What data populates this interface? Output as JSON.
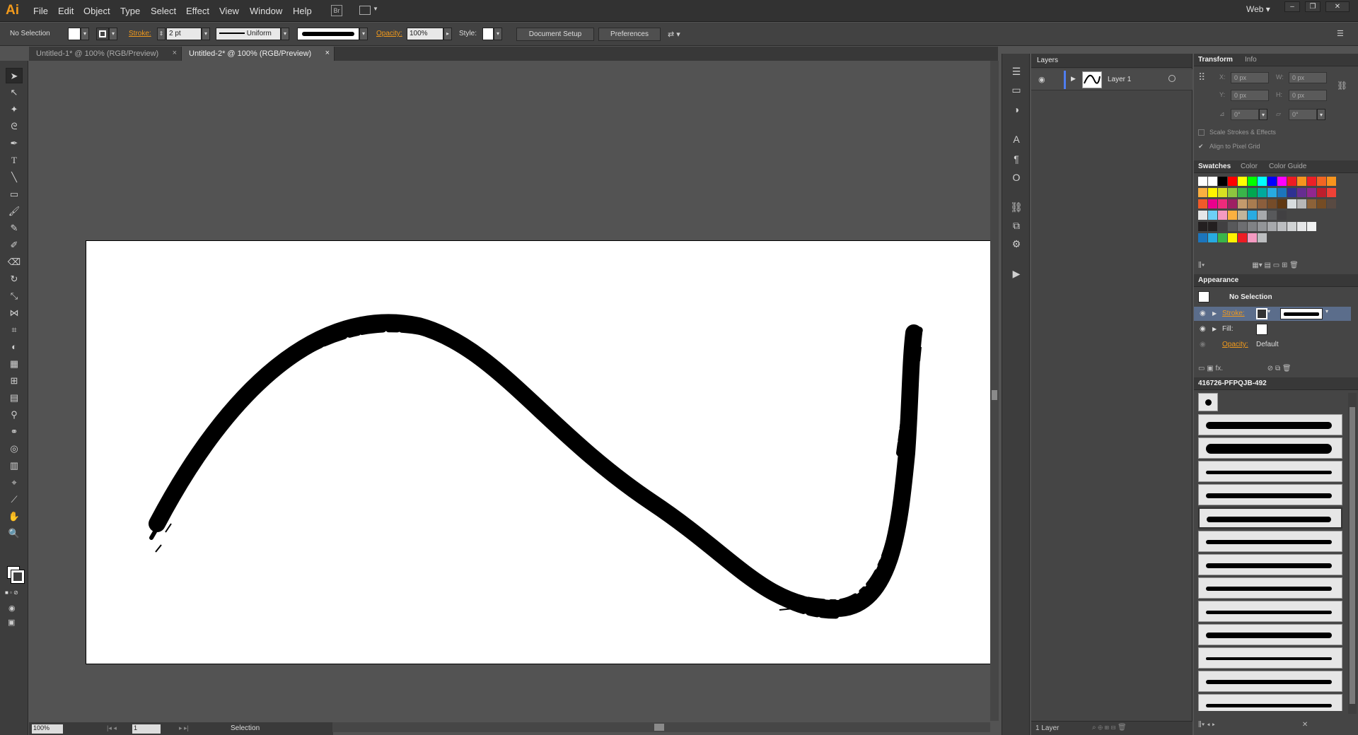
{
  "app": {
    "logo": "Ai",
    "workspace": "Web"
  },
  "menu": [
    "File",
    "Edit",
    "Object",
    "Type",
    "Select",
    "Effect",
    "View",
    "Window",
    "Help"
  ],
  "control_bar": {
    "selection": "No Selection",
    "stroke_label": "Stroke:",
    "stroke_weight": "2 pt",
    "profile": "Uniform",
    "opacity_label": "Opacity:",
    "opacity_value": "100%",
    "style_label": "Style:",
    "document_setup": "Document Setup",
    "preferences": "Preferences"
  },
  "tabs": [
    {
      "label": "Untitled-1* @ 100% (RGB/Preview)",
      "active": false
    },
    {
      "label": "Untitled-2* @ 100% (RGB/Preview)",
      "active": true
    }
  ],
  "status": {
    "zoom": "100%",
    "page": "1",
    "tool": "Selection"
  },
  "layers": {
    "title": "Layers",
    "layer_name": "Layer 1",
    "count": "1 Layer"
  },
  "transform": {
    "tabs": [
      "Transform",
      "Info"
    ],
    "x_label": "X:",
    "x": "0 px",
    "y_label": "Y:",
    "y": "0 px",
    "w_label": "W:",
    "w": "0 px",
    "h_label": "H:",
    "h": "0 px",
    "rotate": "0°",
    "shear": "0°",
    "scale_strokes": "Scale Strokes & Effects",
    "align_pixel": "Align to Pixel Grid"
  },
  "swatches": {
    "tabs": [
      "Swatches",
      "Color",
      "Color Guide"
    ],
    "rows": [
      [
        "#ffffff",
        "#ffffff",
        "#000000",
        "#ff0000",
        "#ffff00",
        "#00ff00",
        "#00ffff",
        "#0000ff",
        "#ff00ff",
        "#ed1c24",
        "#f7941d",
        "#ec2027",
        "#f26522",
        "#f7941d"
      ],
      [
        "#fbb040",
        "#fff200",
        "#d7e021",
        "#8dc63f",
        "#39b54a",
        "#00a651",
        "#00a99d",
        "#27aae1",
        "#1c75bc",
        "#2e3192",
        "#662d91",
        "#92278f",
        "#be1e2d",
        "#ef4136"
      ],
      [
        "#f15a29",
        "#ec008c",
        "#ee2a7b",
        "#9e1f63",
        "#c49a6c",
        "#a97c50",
        "#8b5e3c",
        "#754c29",
        "#603913",
        "#d7dcde",
        "#b7b7b7",
        "#8c6239",
        "#754c24",
        "#594a42"
      ],
      [
        "#e6e7e8",
        "#6dcff6",
        "#f49ac1",
        "#fbb040",
        "#c2b59b",
        "#29abe2",
        "#a7a9ac",
        "#58595b",
        "#414042"
      ],
      [
        "#231f20",
        "#231f20",
        "#414042",
        "#58595b",
        "#6d6e71",
        "#808285",
        "#939598",
        "#a7a9ac",
        "#bcbec0",
        "#d1d3d4",
        "#e6e7e8",
        "#f1f2f2"
      ],
      [
        "#1c75bc",
        "#27aae1",
        "#39b54a",
        "#fff200",
        "#ed1c24",
        "#f49ac1",
        "#bcbec0"
      ]
    ]
  },
  "appearance": {
    "title": "Appearance",
    "header": "No Selection",
    "stroke_label": "Stroke:",
    "fill_label": "Fill:",
    "opacity_label": "Opacity:",
    "opacity_value": "Default",
    "fx": "fx."
  },
  "brushes": {
    "title": "416726-PFPQJB-492",
    "count": 13
  }
}
